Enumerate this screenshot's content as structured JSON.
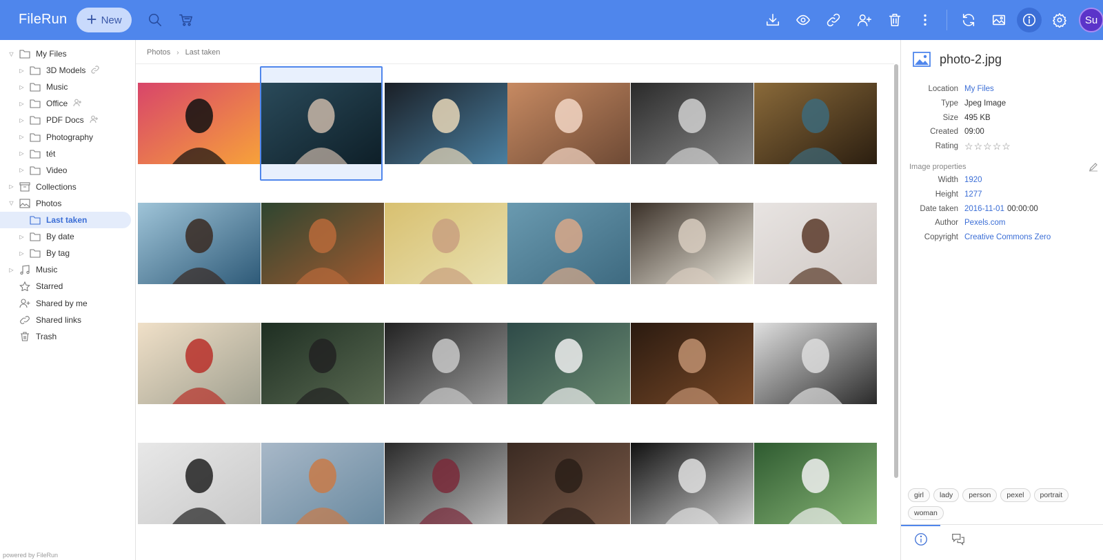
{
  "app": {
    "name": "FileRun",
    "new_label": "New",
    "user_initials": "Su"
  },
  "colors": {
    "topbar": "#4f86ec",
    "accent": "#3b6ed6",
    "avatar": "#5b34c9"
  },
  "toolbar": {
    "left_icons": [
      "search-icon",
      "cart-icon"
    ],
    "right_icons": [
      "download-icon",
      "preview-icon",
      "link-icon",
      "share-user-icon",
      "trash-icon",
      "more-icon",
      "refresh-icon",
      "image-view-icon",
      "info-icon",
      "settings-icon"
    ]
  },
  "sidebar": {
    "items": [
      {
        "label": "My Files",
        "level": 0,
        "arrow": "▽",
        "icon": "folder"
      },
      {
        "label": "3D Models",
        "level": 1,
        "arrow": "▷",
        "icon": "folder",
        "extra": "link"
      },
      {
        "label": "Music",
        "level": 1,
        "arrow": "▷",
        "icon": "folder"
      },
      {
        "label": "Office",
        "level": 1,
        "arrow": "▷",
        "icon": "folder",
        "extra": "user"
      },
      {
        "label": "PDF Docs",
        "level": 1,
        "arrow": "▷",
        "icon": "folder",
        "extra": "user"
      },
      {
        "label": "Photography",
        "level": 1,
        "arrow": "▷",
        "icon": "folder"
      },
      {
        "label": "tét",
        "level": 1,
        "arrow": "▷",
        "icon": "folder"
      },
      {
        "label": "Video",
        "level": 1,
        "arrow": "▷",
        "icon": "folder"
      },
      {
        "label": "Collections",
        "level": 0,
        "arrow": "▷",
        "icon": "archive"
      },
      {
        "label": "Photos",
        "level": 0,
        "arrow": "▽",
        "icon": "image"
      },
      {
        "label": "Last taken",
        "level": 1,
        "arrow": "",
        "icon": "folder",
        "selected": true
      },
      {
        "label": "By date",
        "level": 1,
        "arrow": "▷",
        "icon": "folder"
      },
      {
        "label": "By tag",
        "level": 1,
        "arrow": "▷",
        "icon": "folder"
      },
      {
        "label": "Music",
        "level": 0,
        "arrow": "▷",
        "icon": "music"
      },
      {
        "label": "Starred",
        "level": 0,
        "arrow": "",
        "icon": "star"
      },
      {
        "label": "Shared by me",
        "level": 0,
        "arrow": "",
        "icon": "user"
      },
      {
        "label": "Shared links",
        "level": 0,
        "arrow": "",
        "icon": "link"
      },
      {
        "label": "Trash",
        "level": 0,
        "arrow": "",
        "icon": "trash"
      }
    ],
    "powered_by": "powered by FileRun"
  },
  "breadcrumb": [
    "Photos",
    "Last taken"
  ],
  "grid": {
    "selected_index": 1,
    "photos": [
      {
        "name": "heart-hands",
        "bg": [
          "#d8456a",
          "#f7a23a"
        ],
        "fg": "#111"
      },
      {
        "name": "woman-fur-hood",
        "bg": [
          "#2a4a5a",
          "#0e1f28"
        ],
        "fg": "#c9b7a8"
      },
      {
        "name": "blonde-woman",
        "bg": [
          "#1a1f26",
          "#4a7fa0"
        ],
        "fg": "#e8d7b8"
      },
      {
        "name": "woman-pearls",
        "bg": [
          "#c78a62",
          "#6e4a35"
        ],
        "fg": "#f2d6c4"
      },
      {
        "name": "bw-woman",
        "bg": [
          "#2a2a2a",
          "#8a8a8a"
        ],
        "fg": "#d0d0d0"
      },
      {
        "name": "woman-hat",
        "bg": [
          "#8a6a3a",
          "#2b1e10"
        ],
        "fg": "#3d6a7a"
      },
      {
        "name": "swimmer-sea",
        "bg": [
          "#9fc4d8",
          "#2e5a78"
        ],
        "fg": "#3a2a22"
      },
      {
        "name": "redhead-profile",
        "bg": [
          "#2e4530",
          "#a05a30"
        ],
        "fg": "#b86a3a"
      },
      {
        "name": "blonde-sitting",
        "bg": [
          "#d8c070",
          "#e8e0b0"
        ],
        "fg": "#c9a080"
      },
      {
        "name": "man-lake",
        "bg": [
          "#6a9ab0",
          "#3e6a80"
        ],
        "fg": "#d9a888"
      },
      {
        "name": "window-arms",
        "bg": [
          "#3a3028",
          "#f0ece0"
        ],
        "fg": "#d8ccbf"
      },
      {
        "name": "woman-shoulder",
        "bg": [
          "#e8e4e2",
          "#cfc8c4"
        ],
        "fg": "#5a3a2a"
      },
      {
        "name": "man-red-shirt",
        "bg": [
          "#f0e0c8",
          "#a0a090"
        ],
        "fg": "#b8302a"
      },
      {
        "name": "man-road-forest",
        "bg": [
          "#1e2e22",
          "#5a6a52"
        ],
        "fg": "#222"
      },
      {
        "name": "man-face-bw",
        "bg": [
          "#222",
          "#9a9a9a"
        ],
        "fg": "#c8c8c8"
      },
      {
        "name": "field-walker",
        "bg": [
          "#2e4a48",
          "#6a8a70"
        ],
        "fg": "#eee"
      },
      {
        "name": "man-sunglasses-car",
        "bg": [
          "#2a1a10",
          "#7a4a28"
        ],
        "fg": "#c09070"
      },
      {
        "name": "woman-stripes",
        "bg": [
          "#e0e0e0",
          "#2a2a2a"
        ],
        "fg": "#ddd"
      },
      {
        "name": "man-leather-jacket",
        "bg": [
          "#e8e8e8",
          "#c8c8c8"
        ],
        "fg": "#222"
      },
      {
        "name": "redhead-portrait",
        "bg": [
          "#a8b8c8",
          "#6a8aa0"
        ],
        "fg": "#c87a48"
      },
      {
        "name": "bearded-beanie",
        "bg": [
          "#2a2a2a",
          "#b8b8b8"
        ],
        "fg": "#7a2a3a"
      },
      {
        "name": "pine-forest",
        "bg": [
          "#3a2a22",
          "#7a5a48"
        ],
        "fg": "#2a1e18"
      },
      {
        "name": "bw-man-watch",
        "bg": [
          "#111",
          "#cfcfcf"
        ],
        "fg": "#e0e0e0"
      },
      {
        "name": "green-forest-woman",
        "bg": [
          "#2e5a30",
          "#8ab878"
        ],
        "fg": "#f0f0f0"
      }
    ]
  },
  "details": {
    "filename": "photo-2.jpg",
    "props": [
      {
        "k": "Location",
        "v": "My Files",
        "link": true
      },
      {
        "k": "Type",
        "v": "Jpeg Image"
      },
      {
        "k": "Size",
        "v": "495 KB"
      },
      {
        "k": "Created",
        "v": "09:00"
      },
      {
        "k": "Rating",
        "v": "",
        "stars": 5,
        "rating": 0
      }
    ],
    "image_props_heading": "Image properties",
    "image_props": [
      {
        "k": "Width",
        "v": "1920",
        "link": true
      },
      {
        "k": "Height",
        "v": "1277",
        "link": true
      },
      {
        "k": "Date taken",
        "v": "2016-11-01",
        "v2": "00:00:00",
        "link": true
      },
      {
        "k": "Author",
        "v": "Pexels.com",
        "link": true
      },
      {
        "k": "Copyright",
        "v": "Creative Commons Zero",
        "link": true
      }
    ],
    "tags": [
      "girl",
      "lady",
      "person",
      "pexel",
      "portrait",
      "woman"
    ],
    "tabs": [
      "info-tab-icon",
      "comments-tab-icon"
    ]
  }
}
